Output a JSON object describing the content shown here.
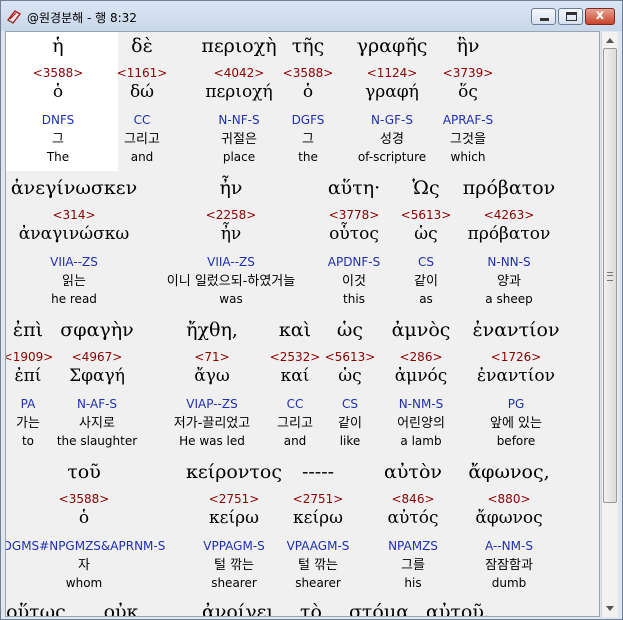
{
  "window": {
    "title": "@원경분해 - 행 8:32",
    "controls": [
      "minimize",
      "maximize",
      "close"
    ],
    "close_glyph": "x"
  },
  "icons": {
    "app": "book-icon"
  },
  "rows": [
    {
      "cells": [
        {
          "greek": "ἡ",
          "number": "<3588>",
          "lemma": "ὁ",
          "parse": "DNFS",
          "korean": "그",
          "english": "The"
        },
        {
          "greek": "δὲ",
          "number": "<1161>",
          "lemma": "δώ",
          "parse": "CC",
          "korean": "그리고",
          "english": "and"
        },
        {
          "greek": "περιοχὴ",
          "number": "<4042>",
          "lemma": "περιοχή",
          "parse": "N-NF-S",
          "korean": "귀절은",
          "english": "place"
        },
        {
          "greek": "τῆς",
          "number": "<3588>",
          "lemma": "ὁ",
          "parse": "DGFS",
          "korean": "그",
          "english": "the"
        },
        {
          "greek": "γραφῆς",
          "number": "<1124>",
          "lemma": "γραφή",
          "parse": "N-GF-S",
          "korean": "성경",
          "english": "of-scripture"
        },
        {
          "greek": "ἣν",
          "number": "<3739>",
          "lemma": "ὅς",
          "parse": "APRAF-S",
          "korean": "그것을",
          "english": "which"
        }
      ]
    },
    {
      "cells": [
        {
          "greek": "ἀνεγίνωσκεν",
          "number": "<314>",
          "lemma": "ἀναγινώσκω",
          "parse": "VIIA--ZS",
          "korean": "읽는",
          "english": "he read"
        },
        {
          "greek": "ἦν",
          "number": "<2258>",
          "lemma": "ἦν",
          "parse": "VIIA--ZS",
          "korean": "이니 일렀으되-하였거늘",
          "english": "was"
        },
        {
          "greek": "αὕτη·",
          "number": "<3778>",
          "lemma": "οὗτος",
          "parse": "APDNF-S",
          "korean": "이것",
          "english": "this"
        },
        {
          "greek": "Ὡς",
          "number": "<5613>",
          "lemma": "ὡς",
          "parse": "CS",
          "korean": "같이",
          "english": "as"
        },
        {
          "greek": "πρόβατον",
          "number": "<4263>",
          "lemma": "πρόβατον",
          "parse": "N-NN-S",
          "korean": "양과",
          "english": "a sheep"
        }
      ]
    },
    {
      "cells": [
        {
          "greek": "ἐπὶ",
          "number": "<1909>",
          "lemma": "ἐπί",
          "parse": "PA",
          "korean": "가는",
          "english": "to"
        },
        {
          "greek": "σφαγὴν",
          "number": "<4967>",
          "lemma": "Σφαγή",
          "parse": "N-AF-S",
          "korean": "사지로",
          "english": "the slaughter"
        },
        {
          "greek": "ἤχθη,",
          "number": "<71>",
          "lemma": "ἄγω",
          "parse": "VIAP--ZS",
          "korean": "저가-끌리었고",
          "english": "He was led"
        },
        {
          "greek": "καὶ",
          "number": "<2532>",
          "lemma": "καί",
          "parse": "CC",
          "korean": "그리고",
          "english": "and"
        },
        {
          "greek": "ὡς",
          "number": "<5613>",
          "lemma": "ὡς",
          "parse": "CS",
          "korean": "같이",
          "english": "like"
        },
        {
          "greek": "ἀμνὸς",
          "number": "<286>",
          "lemma": "ἀμνός",
          "parse": "N-NM-S",
          "korean": "어린양의",
          "english": "a lamb"
        },
        {
          "greek": "ἐναντίον",
          "number": "<1726>",
          "lemma": "ἐναντίον",
          "parse": "PG",
          "korean": "앞에 있는",
          "english": "before"
        }
      ]
    },
    {
      "cells": [
        {
          "greek": "τοῦ",
          "number": "<3588>",
          "lemma": "ὁ",
          "parse": "DGMS#NPGMZS&APRNM-S",
          "korean": "자",
          "english": "whom"
        },
        {
          "greek": "κείροντος",
          "number": "<2751>",
          "lemma": "κείρω",
          "parse": "VPPAGM-S",
          "korean": "털 깎는",
          "english": "shearer"
        },
        {
          "greek": "-----",
          "number": "<2751>",
          "lemma": "κείρω",
          "parse": "VPAAGM-S",
          "korean": "털 깎는",
          "english": "shearer"
        },
        {
          "greek": "αὐτὸν",
          "number": "<846>",
          "lemma": "αὐτός",
          "parse": "NPAMZS",
          "korean": "그를",
          "english": "his"
        },
        {
          "greek": "ἄφωνος,",
          "number": "<880>",
          "lemma": "ἄφωνος",
          "parse": "A--NM-S",
          "korean": "잠잠함과",
          "english": "dumb"
        }
      ]
    },
    {
      "cells": [
        {
          "greek": "οὕτως"
        },
        {
          "greek": "οὐκ"
        },
        {
          "greek": "ἀνοίγει"
        },
        {
          "greek": "τὸ"
        },
        {
          "greek": "στόμα"
        },
        {
          "greek": "αὐτοῦ."
        }
      ]
    }
  ]
}
